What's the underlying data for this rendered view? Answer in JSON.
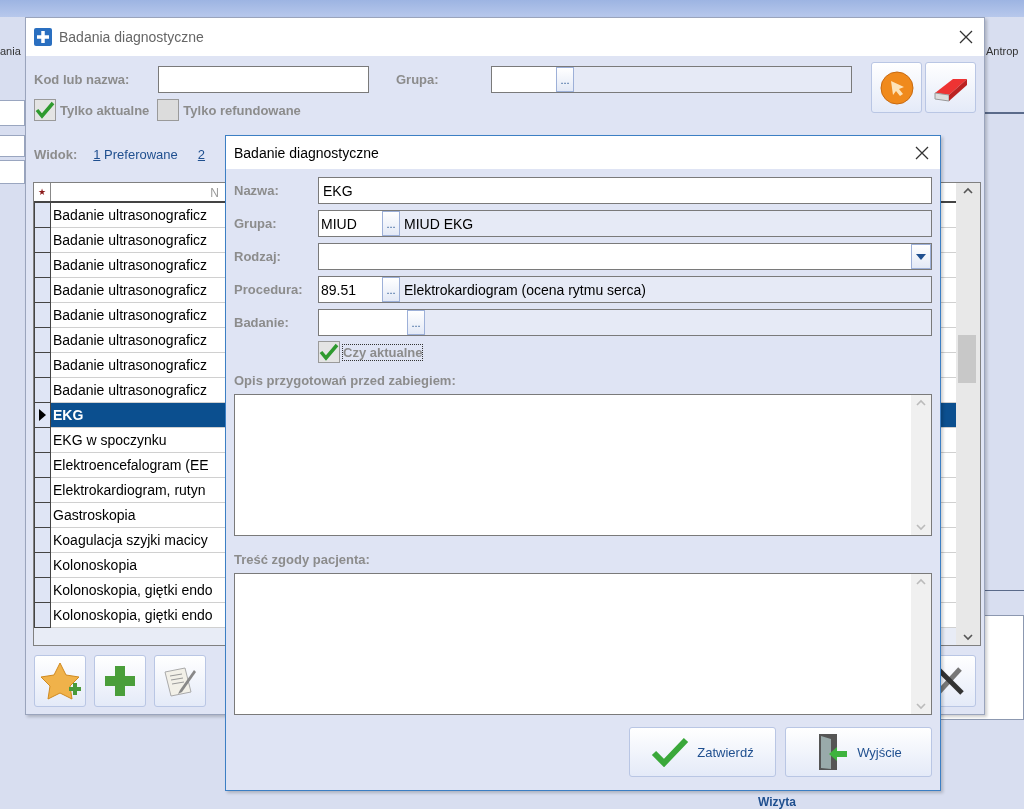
{
  "app": {
    "toolbar_labels": [
      "ania",
      "Antrop"
    ],
    "section_title": "Wizyta"
  },
  "outer": {
    "title": "Badania diagnostyczne",
    "filters": {
      "code_label": "Kod lub nazwa:",
      "group_label": "Grupa:",
      "group_button": "...",
      "checkboxes": [
        {
          "label": "Tylko aktualne",
          "checked": true
        },
        {
          "label": "Tylko refundowane",
          "checked": false
        }
      ]
    },
    "view": {
      "label": "Widok:",
      "options": [
        {
          "key": "1",
          "label": "Preferowane"
        },
        {
          "key": "2"
        }
      ]
    },
    "grid": {
      "marker_header": "★",
      "name_header": "N",
      "rows": [
        {
          "name": "Badanie ultrasonograficz",
          "selected": false
        },
        {
          "name": "Badanie ultrasonograficz",
          "selected": false
        },
        {
          "name": "Badanie ultrasonograficz",
          "selected": false
        },
        {
          "name": "Badanie ultrasonograficz",
          "selected": false
        },
        {
          "name": "Badanie ultrasonograficz",
          "selected": false
        },
        {
          "name": "Badanie ultrasonograficz",
          "selected": false
        },
        {
          "name": "Badanie ultrasonograficz",
          "selected": false
        },
        {
          "name": "Badanie ultrasonograficz",
          "selected": false
        },
        {
          "name": "EKG",
          "selected": true
        },
        {
          "name": "EKG w spoczynku",
          "selected": false
        },
        {
          "name": "Elektroencefalogram (EE",
          "selected": false
        },
        {
          "name": "Elektrokardiogram, rutyn",
          "selected": false
        },
        {
          "name": "Gastroskopia",
          "selected": false
        },
        {
          "name": "Koagulacja szyjki macicy",
          "selected": false
        },
        {
          "name": "Kolonoskopia",
          "selected": false
        },
        {
          "name": "Kolonoskopia, giętki endo",
          "selected": false
        },
        {
          "name": "Kolonoskopia, giętki endo",
          "selected": false
        }
      ]
    }
  },
  "dialog": {
    "title": "Badanie diagnostyczne",
    "fields": [
      {
        "kind": "text",
        "label": "Nazwa:",
        "value": "EKG"
      },
      {
        "kind": "lookup",
        "label": "Grupa:",
        "value": "MIUD",
        "button": "...",
        "description": "MIUD EKG"
      },
      {
        "kind": "combo",
        "label": "Rodzaj:"
      },
      {
        "kind": "lookup",
        "label": "Procedura:",
        "value": "89.51",
        "button": "...",
        "description": "Elektrokardiogram (ocena rytmu serca)"
      },
      {
        "kind": "lookup",
        "label": "Badanie:",
        "button": "..."
      }
    ],
    "checkbox": {
      "label": "Czy aktualne",
      "checked": true
    },
    "memos": [
      {
        "label": "Opis przygotowań przed zabiegiem:"
      },
      {
        "label": "Treść zgody pacjenta:"
      }
    ],
    "buttons": [
      {
        "kind": "confirm",
        "label": "Zatwierdź"
      },
      {
        "kind": "exit",
        "label": "Wyjście"
      }
    ]
  }
}
